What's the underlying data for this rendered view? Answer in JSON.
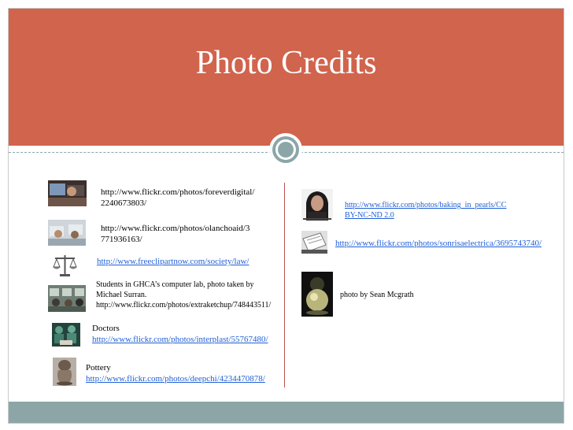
{
  "slide": {
    "title": "Photo Credits",
    "colors": {
      "header": "#d1644d",
      "accent": "#8ca6a8",
      "divider": "#c0504d",
      "link": "#1f5fd6"
    }
  },
  "credits_left": [
    {
      "lines": [
        "http://www.flickr.com/photos/foreverdigital/",
        "2240673803/"
      ]
    },
    {
      "lines": [
        "http://www.flickr.com/photos/olanchoaid/3",
        "771936163/"
      ]
    },
    {
      "link": "http://www.freeclipartnow.com/society/law/"
    },
    {
      "lines": [
        "Students in GHCA’s computer lab, photo taken by",
        "Michael Surran.",
        "http://www.flickr.com/photos/extraketchup/748443511/"
      ]
    },
    {
      "caption": "Doctors",
      "link": "http://www.flickr.com/photos/interplast/55767480/"
    },
    {
      "caption": "Pottery",
      "link": "http://www.flickr.com/photos/deepchi/4234470878/"
    }
  ],
  "credits_right": [
    {
      "lines": [
        "http://www.flickr.com/photos/baking_in_pearls/CC",
        "BY-NC-ND 2.0"
      ]
    },
    {
      "link": "http://www.flickr.com/photos/sonrisaelectrica/3695743740/"
    },
    {
      "text": "photo by Sean Mcgrath"
    }
  ]
}
